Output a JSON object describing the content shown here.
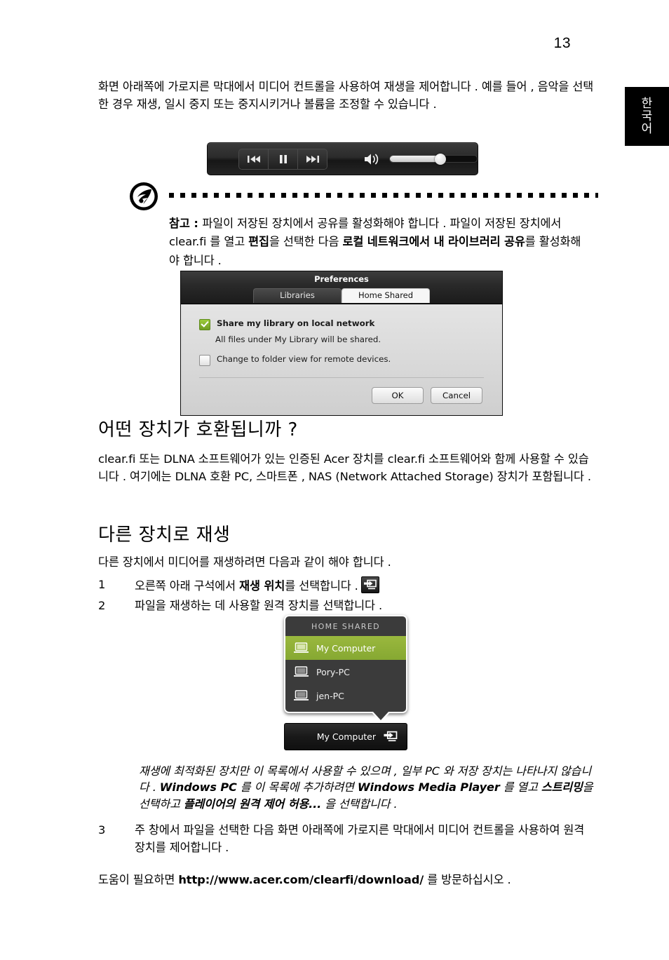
{
  "page": {
    "number": "13",
    "side_tab": {
      "chars": [
        "한",
        "국",
        "어"
      ]
    }
  },
  "intro": {
    "paragraph": "화면 아래쪽에 가로지른 막대에서 미디어 컨트롤을 사용하여 재생을 제어합니다 . 예를 들어 , 음악을 선택한 경우 재생, 일시 중지 또는 중지시키거나 볼륨을 조정할 수 있습니다 ."
  },
  "media_bar": {
    "previous_label": "previous-track",
    "pause_label": "pause",
    "next_label": "next-track",
    "volume_label": "volume",
    "volume_percent": 58
  },
  "note": {
    "icon": "acer-note-icon",
    "prefix": "참고 : ",
    "text_1": "파일이 저장된 장치에서 공유를 활성화해야 합니다 . 파일이 저장된 장치에서 clear.fi 를 열고 ",
    "bold_1": "편집",
    "text_2": "을 선택한 다음 ",
    "bold_2": "로컬 네트워크에서 내 라이브러리 공유",
    "text_3": "를 활성화해야 합니다 ."
  },
  "preferences_dialog": {
    "title": "Preferences",
    "tabs": [
      {
        "label": "Libraries",
        "active": false
      },
      {
        "label": "Home Shared",
        "active": true
      }
    ],
    "checkbox_share": {
      "label": "Share my library on local network",
      "checked": true
    },
    "share_description": "All files under My Library will be shared.",
    "checkbox_folder_view": {
      "label": "Change to folder view for remote devices.",
      "checked": false
    },
    "buttons": [
      {
        "label": "OK"
      },
      {
        "label": "Cancel"
      }
    ]
  },
  "section_compatible": {
    "heading": "어떤 장치가 호환됩니까 ?",
    "paragraph": "clear.fi 또는 DLNA 소프트웨어가 있는 인증된 Acer 장치를 clear.fi 소프트웨어와 함께 사용할 수 있습니다 . 여기에는 DLNA 호환 PC, 스마트폰 , NAS (Network Attached Storage) 장치가 포함됩니다 ."
  },
  "section_playto": {
    "heading": "다른 장치로 재생",
    "paragraph": "다른 장치에서 미디어를 재생하려면 다음과 같이 해야 합니다 .",
    "steps": [
      {
        "number": "1",
        "text_1": "오른쪽 아래 구석에서 ",
        "bold": "재생 위치",
        "text_2": "를 선택합니다 .",
        "icon": "play-to-icon"
      },
      {
        "number": "2",
        "text_1": "파일을 재생하는 데 사용할 원격 장치를 선택합니다 ."
      },
      {
        "number": "3",
        "text_1": "주 창에서 파일을 선택한 다음 화면 아래쪽에 가로지른 막대에서 미디어 컨트롤을 사용하여 원격 장치를 제어합니다 ."
      }
    ]
  },
  "device_popup": {
    "header": "HOME SHARED",
    "items": [
      {
        "label": "My Computer",
        "selected": true
      },
      {
        "label": "Pory-PC",
        "selected": false
      },
      {
        "label": "jen-PC",
        "selected": false
      }
    ],
    "status_bar": {
      "label": "My Computer",
      "icon": "play-to-icon"
    },
    "highlight_color": "#91b33b"
  },
  "italic_note": {
    "text_1": "재생에 최적화된 장치만 이 목록에서 사용할 수 있으며 , 일부 PC 와 저장 장치는 나타나지 않습니다 . ",
    "bold_1": "Windows PC",
    "text_2": " 를 이 목록에 추가하려면 ",
    "bold_2": "Windows Media Player",
    "text_3": " 를 열고 ",
    "bold_3": "스트리밍",
    "text_4": "을 선택하고 ",
    "bold_4": "플레이어의 원격 제어 허용...",
    "text_5": " 을 선택합니다 ."
  },
  "closing": {
    "text_1": "도움이 필요하면 ",
    "url": "http://www.acer.com/clearfi/download/",
    "text_2": " 를 방문하십시오 ."
  }
}
